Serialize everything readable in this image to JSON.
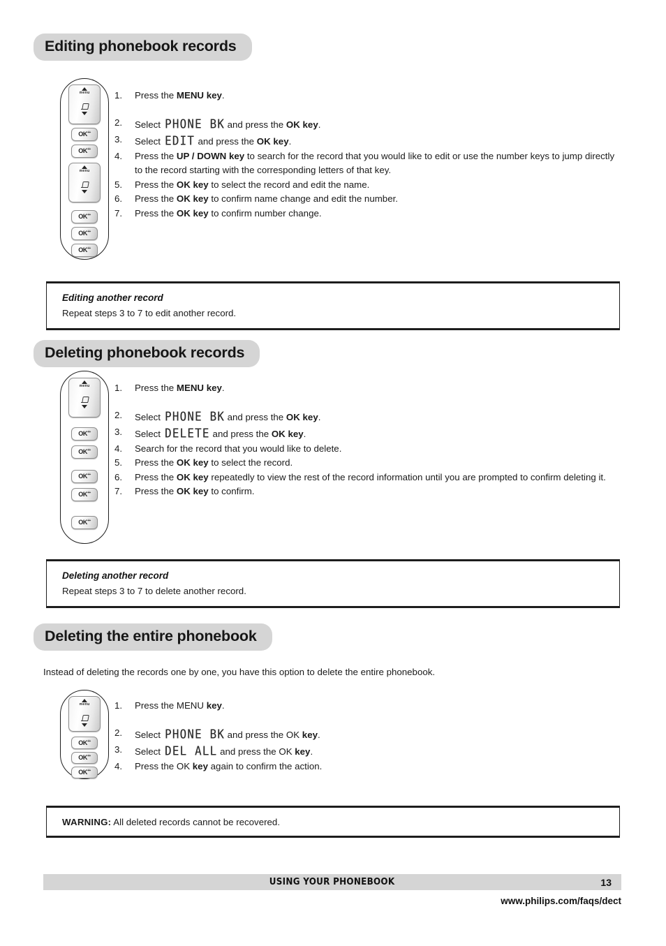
{
  "sections": [
    {
      "id": "editing",
      "heading": "Editing phonebook records",
      "steps": [
        {
          "num": "1.",
          "parts": [
            {
              "t": "text",
              "v": "Press the "
            },
            {
              "t": "bold",
              "v": "MENU key"
            },
            {
              "t": "text",
              "v": "."
            }
          ]
        },
        {
          "num": "2.",
          "parts": [
            {
              "t": "text",
              "v": "Select "
            },
            {
              "t": "lcd",
              "v": "PHONE BK"
            },
            {
              "t": "text",
              "v": " and press the "
            },
            {
              "t": "bold",
              "v": "OK key"
            },
            {
              "t": "text",
              "v": "."
            }
          ]
        },
        {
          "num": "3.",
          "parts": [
            {
              "t": "text",
              "v": "Select "
            },
            {
              "t": "lcd",
              "v": "EDIT"
            },
            {
              "t": "text",
              "v": " and press the "
            },
            {
              "t": "bold",
              "v": "OK key"
            },
            {
              "t": "text",
              "v": "."
            }
          ]
        },
        {
          "num": "4.",
          "parts": [
            {
              "t": "text",
              "v": "Press the "
            },
            {
              "t": "bold",
              "v": "UP / DOWN key"
            },
            {
              "t": "text",
              "v": " to search for the record that you would like to edit or use the number keys to jump directly to the record starting with the corresponding letters of that key."
            }
          ]
        },
        {
          "num": "5.",
          "parts": [
            {
              "t": "text",
              "v": "Press the "
            },
            {
              "t": "bold",
              "v": "OK key"
            },
            {
              "t": "text",
              "v": " to select the record and edit the name."
            }
          ]
        },
        {
          "num": "6.",
          "parts": [
            {
              "t": "text",
              "v": "Press the "
            },
            {
              "t": "bold",
              "v": "OK key"
            },
            {
              "t": "text",
              "v": " to confirm name change and edit the number."
            }
          ]
        },
        {
          "num": "7.",
          "parts": [
            {
              "t": "text",
              "v": "Press the "
            },
            {
              "t": "bold",
              "v": "OK key"
            },
            {
              "t": "text",
              "v": " to confirm number change."
            }
          ]
        }
      ]
    },
    {
      "id": "deleting",
      "heading": "Deleting phonebook records",
      "steps": [
        {
          "num": "1.",
          "parts": [
            {
              "t": "text",
              "v": "Press the "
            },
            {
              "t": "bold",
              "v": "MENU key"
            },
            {
              "t": "text",
              "v": "."
            }
          ]
        },
        {
          "num": "2.",
          "parts": [
            {
              "t": "text",
              "v": "Select "
            },
            {
              "t": "lcd",
              "v": "PHONE BK"
            },
            {
              "t": "text",
              "v": " and press the "
            },
            {
              "t": "bold",
              "v": "OK key"
            },
            {
              "t": "text",
              "v": "."
            }
          ]
        },
        {
          "num": "3.",
          "parts": [
            {
              "t": "text",
              "v": "Select "
            },
            {
              "t": "lcd",
              "v": "DELETE"
            },
            {
              "t": "text",
              "v": " and press the "
            },
            {
              "t": "bold",
              "v": "OK key"
            },
            {
              "t": "text",
              "v": "."
            }
          ]
        },
        {
          "num": "4.",
          "parts": [
            {
              "t": "text",
              "v": "Search for the record that you would like to delete."
            }
          ]
        },
        {
          "num": "5.",
          "parts": [
            {
              "t": "text",
              "v": "Press the "
            },
            {
              "t": "bold",
              "v": "OK key"
            },
            {
              "t": "text",
              "v": " to select the record."
            }
          ]
        },
        {
          "num": "6.",
          "parts": [
            {
              "t": "text",
              "v": "Press the "
            },
            {
              "t": "bold",
              "v": "OK key"
            },
            {
              "t": "text",
              "v": " repeatedly to view the rest of the record information until you are prompted to confirm deleting it."
            }
          ]
        },
        {
          "num": "7.",
          "parts": [
            {
              "t": "text",
              "v": "Press the "
            },
            {
              "t": "bold",
              "v": "OK key"
            },
            {
              "t": "text",
              "v": " to confirm."
            }
          ]
        }
      ]
    },
    {
      "id": "delete-all",
      "heading": "Deleting the entire phonebook",
      "intro": "Instead of deleting the records one by one, you have this option to delete the entire phonebook.",
      "steps": [
        {
          "num": "1.",
          "parts": [
            {
              "t": "text",
              "v": "Press the MENU "
            },
            {
              "t": "bold",
              "v": "key"
            },
            {
              "t": "text",
              "v": "."
            }
          ]
        },
        {
          "num": "2.",
          "parts": [
            {
              "t": "text",
              "v": "Select "
            },
            {
              "t": "lcd",
              "v": "PHONE BK"
            },
            {
              "t": "text",
              "v": " and press the OK "
            },
            {
              "t": "bold",
              "v": "key"
            },
            {
              "t": "text",
              "v": "."
            }
          ]
        },
        {
          "num": "3.",
          "parts": [
            {
              "t": "text",
              "v": "Select "
            },
            {
              "t": "lcd",
              "v": "DEL ALL"
            },
            {
              "t": "text",
              "v": " and press the OK "
            },
            {
              "t": "bold",
              "v": "key"
            },
            {
              "t": "text",
              "v": "."
            }
          ]
        },
        {
          "num": "4.",
          "parts": [
            {
              "t": "text",
              "v": "Press the OK "
            },
            {
              "t": "bold",
              "v": "key"
            },
            {
              "t": "text",
              "v": " again to confirm the action."
            }
          ]
        }
      ]
    }
  ],
  "notes": [
    {
      "id": "editing-another",
      "title": "Editing another record",
      "body": "Repeat steps 3 to 7 to edit another record."
    },
    {
      "id": "deleting-another",
      "title": "Deleting another record",
      "body": "Repeat steps 3 to 7 to delete another record."
    }
  ],
  "warning": {
    "label": "WARNING:",
    "body": "All deleted records cannot be recovered."
  },
  "keys": {
    "nav_label": "menu",
    "ok_label": "OK",
    "ok_superscript": "++"
  },
  "footer": {
    "title": "USING YOUR PHONEBOOK",
    "page": "13",
    "url": "www.philips.com/faqs/dect"
  },
  "colors": {
    "pill_gray": "#d5d5d5",
    "footer_gray": "#d5d5d5",
    "rule_black": "#1d1d1d",
    "text": "#1a1a1a"
  }
}
